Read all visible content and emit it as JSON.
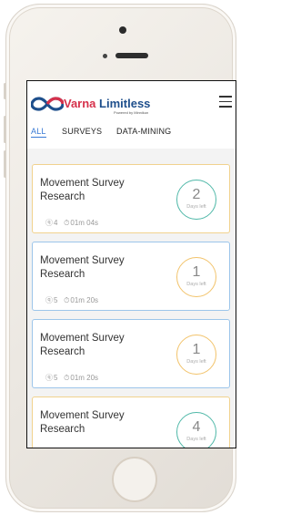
{
  "brand": {
    "name_part1": "Varna",
    "name_part2": "Limitless",
    "powered_by": "Powered by Minnikun"
  },
  "tabs": [
    {
      "label": "ALL",
      "active": true
    },
    {
      "label": "SURVEYS",
      "active": false
    },
    {
      "label": "DATA-MINING",
      "active": false
    }
  ],
  "cards": [
    {
      "title": "Movement Survey Research",
      "questions": "4",
      "duration": "01m 04s",
      "days": "2",
      "days_label": "Days left",
      "accent": "teal"
    },
    {
      "title": "Movement Survey Research",
      "questions": "5",
      "duration": "01m 20s",
      "days": "1",
      "days_label": "Days left",
      "accent": "amber"
    },
    {
      "title": "Movement Survey Research",
      "questions": "5",
      "duration": "01m 20s",
      "days": "1",
      "days_label": "Days left",
      "accent": "amber"
    },
    {
      "title": "Movement Survey Research",
      "questions": "",
      "duration": "",
      "days": "4",
      "days_label": "Days left",
      "accent": "teal"
    }
  ],
  "colors": {
    "brand_red": "#d6314b",
    "brand_blue": "#1e4f8c",
    "tab_active": "#3a7bd5",
    "teal": "#4fb8a8",
    "amber": "#f2c36b"
  }
}
